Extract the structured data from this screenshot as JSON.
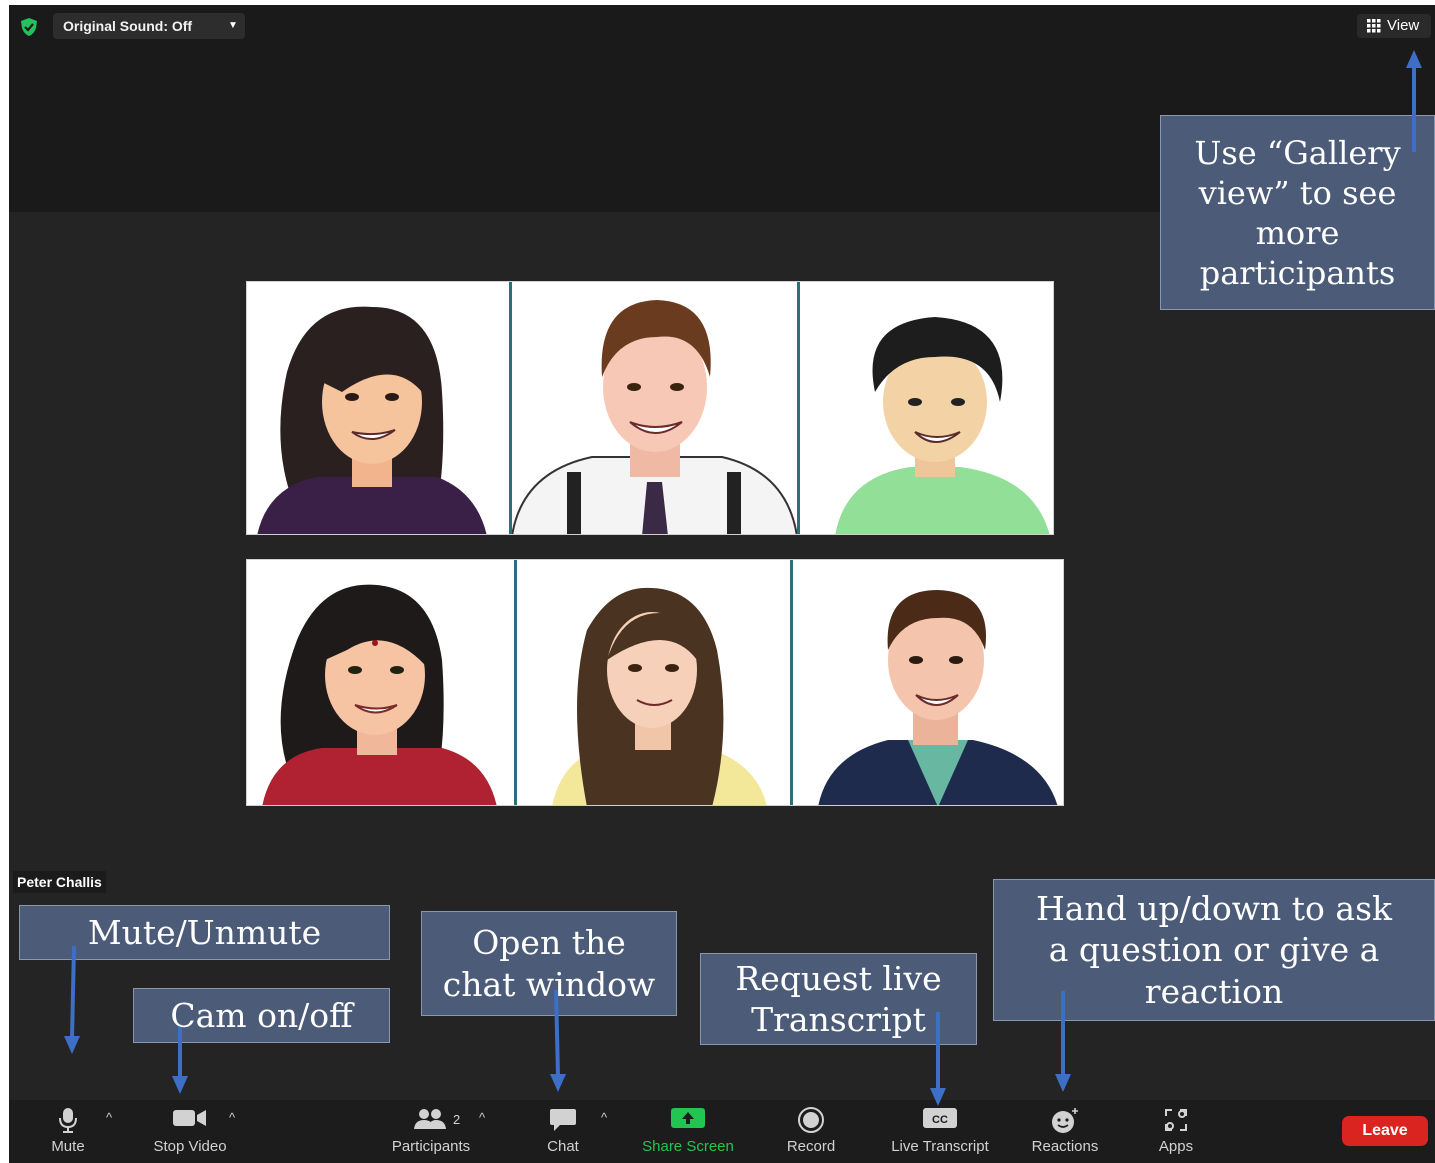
{
  "top_bar": {
    "original_sound_label": "Original Sound: Off",
    "view_label": "View",
    "icons": [
      "shield-check-icon",
      "chevron-down-icon",
      "grid-icon"
    ]
  },
  "speaker_name": "Peter Challis",
  "toolbar": {
    "mute": "Mute",
    "stop_video": "Stop Video",
    "participants": "Participants",
    "participants_count": "2",
    "chat": "Chat",
    "share_screen": "Share Screen",
    "record": "Record",
    "live_transcript": "Live Transcript",
    "reactions": "Reactions",
    "apps": "Apps",
    "leave": "Leave",
    "icons": [
      "microphone-icon",
      "video-camera-icon",
      "participants-icon",
      "chat-bubble-icon",
      "share-screen-icon",
      "record-icon",
      "closed-caption-icon",
      "reaction-icon",
      "apps-icon"
    ]
  },
  "callouts": {
    "gallery": "Use “Gallery view” to see more participants",
    "mute": "Mute/Unmute",
    "cam": "Cam on/off",
    "chat": "Open the chat window",
    "transcript": "Request live Transcript",
    "hand": "Hand up/down to ask a question or give a reaction"
  },
  "participant_images": [
    "woman-long-dark-hair",
    "man-white-shirt-tie-suspenders",
    "person-short-black-hair-green-shirt",
    "woman-bindi-red-top",
    "woman-long-brown-hair-yellow-top",
    "man-dark-suit"
  ],
  "colors": {
    "accent_green": "#23c552",
    "leave_red": "#d9241f",
    "callout_bg": "#4b5b78",
    "arrow_blue": "#3e6fc7"
  }
}
